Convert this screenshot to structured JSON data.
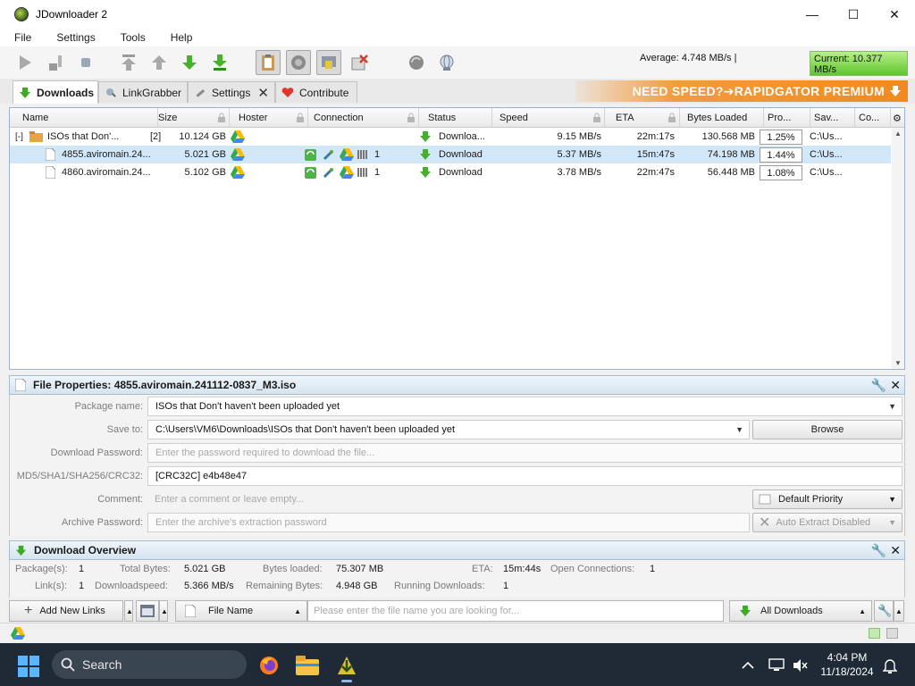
{
  "window": {
    "title": "JDownloader 2",
    "minimize": "—",
    "maximize": "☐",
    "close": "✕"
  },
  "menu": [
    "File",
    "Settings",
    "Tools",
    "Help"
  ],
  "speed": {
    "average": "Average: 4.748 MB/s |",
    "current": "Current: 10.377 MB/s"
  },
  "tabs": [
    {
      "label": "Downloads",
      "active": true
    },
    {
      "label": "LinkGrabber"
    },
    {
      "label": "Settings",
      "closable": true,
      "close": "✕"
    },
    {
      "label": "Contribute"
    }
  ],
  "banner": "NEED SPEED?➔RAPIDGATOR PREMIUM",
  "table": {
    "columns": [
      "Name",
      "Size",
      "Hoster",
      "Connection",
      "Status",
      "Speed",
      "ETA",
      "Bytes Loaded",
      "Pro...",
      "Sav...",
      "Co..."
    ],
    "package": {
      "expander": "[-]",
      "name": "ISOs that Don'...",
      "count": "[2]",
      "size": "10.124 GB",
      "status": "Downloa...",
      "speed": "9.15 MB/s",
      "eta": "22m:17s",
      "bytes": "130.568 MB",
      "progress": "1.25%",
      "save": "C:\\Us..."
    },
    "rows": [
      {
        "name": "4855.aviromain.24...",
        "size": "5.021 GB",
        "connections": "1",
        "status": "Download",
        "speed": "5.37 MB/s",
        "eta": "15m:47s",
        "bytes": "74.198 MB",
        "progress": "1.44%",
        "save": "C:\\Us...",
        "selected": true
      },
      {
        "name": "4860.aviromain.24...",
        "size": "5.102 GB",
        "connections": "1",
        "status": "Download",
        "speed": "3.78 MB/s",
        "eta": "22m:47s",
        "bytes": "56.448 MB",
        "progress": "1.08%",
        "save": "C:\\Us...",
        "selected": false
      }
    ]
  },
  "file_properties": {
    "title": "File Properties: 4855.aviromain.241112-0837_M3.iso",
    "labels": {
      "package": "Package name:",
      "save": "Save to:",
      "password": "Download Password:",
      "checksum": "MD5/SHA1/SHA256/CRC32:",
      "comment": "Comment:",
      "archive": "Archive Password:"
    },
    "package_name": "ISOs that Don't haven't been uploaded yet",
    "save_to": "C:\\Users\\VM6\\Downloads\\ISOs that Don't haven't been uploaded yet",
    "browse": "Browse",
    "password_placeholder": "Enter the password required to download the file...",
    "checksum": "[CRC32C] e4b48e47",
    "comment_placeholder": "Enter a comment or leave empty...",
    "priority": "Default Priority",
    "archive_placeholder": "Enter the archive's extraction password",
    "auto_extract": "Auto Extract Disabled"
  },
  "overview": {
    "title": "Download Overview",
    "packages_label": "Package(s):",
    "packages": "1",
    "links_label": "Link(s):",
    "links": "1",
    "total_bytes_label": "Total Bytes:",
    "total_bytes": "5.021 GB",
    "dl_speed_label": "Downloadspeed:",
    "dl_speed": "5.366 MB/s",
    "bytes_loaded_label": "Bytes loaded:",
    "bytes_loaded": "75.307 MB",
    "remaining_label": "Remaining Bytes:",
    "remaining": "4.948 GB",
    "eta_label": "ETA:",
    "eta": "15m:44s",
    "running_label": "Running Downloads:",
    "running": "1",
    "open_conn_label": "Open Connections:",
    "open_conn": "1"
  },
  "bottom": {
    "add_links": "Add New Links",
    "filter_field": "File Name",
    "search_placeholder": "Please enter the file name you are looking for...",
    "view": "All Downloads"
  },
  "taskbar": {
    "search": "Search",
    "time": "4:04 PM",
    "date": "11/18/2024"
  },
  "colors": {
    "accent": "#1e88e5",
    "banner": "#f08a1f",
    "selection": "#d2e8f8",
    "green": "#37b24d"
  }
}
